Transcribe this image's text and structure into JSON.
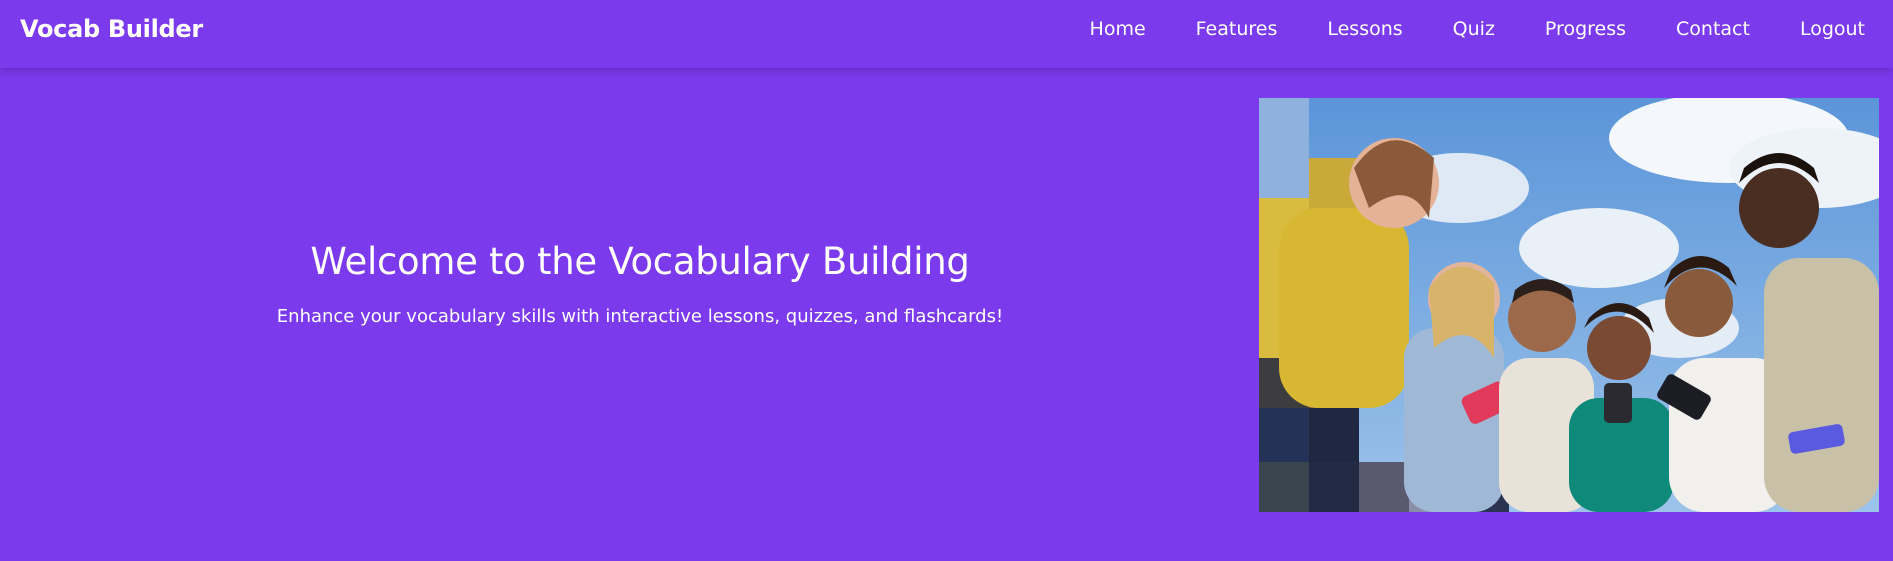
{
  "nav": {
    "brand": "Vocab Builder",
    "links": [
      "Home",
      "Features",
      "Lessons",
      "Quiz",
      "Progress",
      "Contact",
      "Logout"
    ]
  },
  "hero": {
    "title": "Welcome to the Vocabulary Building",
    "subtitle": "Enhance your vocabulary skills with interactive lessons, quizzes, and flashcards!"
  },
  "colors": {
    "primary": "#7c3aed",
    "text": "#ffffff"
  }
}
